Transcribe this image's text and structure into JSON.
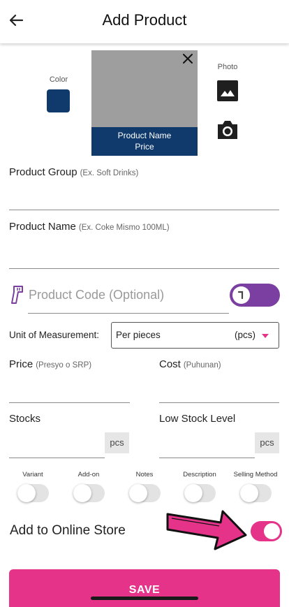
{
  "header": {
    "title": "Add Product",
    "back_icon": "arrow-left-icon"
  },
  "colors": {
    "accent": "#e5338a",
    "purple": "#7a3fa0",
    "navy": "#0f3a6b",
    "preview_bg": "#9e9e9e"
  },
  "color_picker": {
    "label": "Color",
    "value": "#0f3a6b"
  },
  "preview": {
    "name": "Product Name",
    "price": "Price",
    "close_icon": "close-icon"
  },
  "photo": {
    "label": "Photo",
    "gallery_icon": "image-icon",
    "camera_icon": "camera-icon"
  },
  "product_group": {
    "label": "Product Group",
    "hint": "(Ex. Soft Drinks)",
    "value": ""
  },
  "product_name": {
    "label": "Product Name",
    "hint": "(Ex. Coke Mismo 100ML)",
    "value": ""
  },
  "product_code": {
    "placeholder": "Product Code (Optional)",
    "icon": "barcode-scanner-icon",
    "toggle_on": true
  },
  "uom": {
    "label": "Unit of Measurement:",
    "value": "Per pieces",
    "unit": "(pcs)"
  },
  "price": {
    "label": "Price",
    "hint": "(Presyo o SRP)",
    "value": ""
  },
  "cost": {
    "label": "Cost",
    "hint": "(Puhunan)",
    "value": ""
  },
  "stocks": {
    "label": "Stocks",
    "unit": "pcs",
    "value": ""
  },
  "low_stock": {
    "label": "Low Stock Level",
    "unit": "pcs",
    "value": ""
  },
  "options": [
    {
      "label": "Variant",
      "on": false
    },
    {
      "label": "Add-on",
      "on": false
    },
    {
      "label": "Notes",
      "on": false
    },
    {
      "label": "Description",
      "on": false
    },
    {
      "label": "Selling Method",
      "on": false
    }
  ],
  "online_store": {
    "label": "Add to Online Store",
    "on": true
  },
  "save_button": {
    "label": "SAVE"
  }
}
